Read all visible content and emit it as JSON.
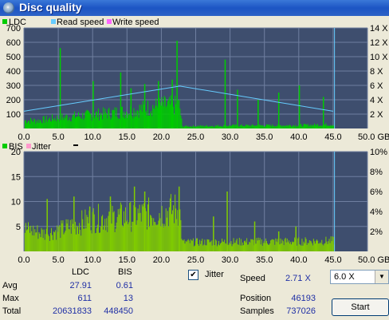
{
  "window": {
    "title": "Disc quality"
  },
  "chart_data": [
    {
      "type": "bar",
      "legend": [
        "LDC",
        "Read speed",
        "Write speed"
      ],
      "x_ticks": [
        "0.0",
        "5.0",
        "10.0",
        "15.0",
        "20.0",
        "25.0",
        "30.0",
        "35.0",
        "40.0",
        "45.0",
        "50.0 GB"
      ],
      "y_ticks_left": [
        "100",
        "200",
        "300",
        "400",
        "500",
        "600",
        "700"
      ],
      "y_ticks_right": [
        "2 X",
        "4 X",
        "6 X",
        "8 X",
        "10 X",
        "12 X",
        "14 X"
      ],
      "xlim": [
        0,
        50
      ],
      "ylim": [
        0,
        700
      ],
      "y2lim": [
        0,
        14
      ],
      "ldc_profile": {
        "x": [
          0,
          2,
          5,
          10,
          15,
          20,
          22.6,
          23,
          30,
          40,
          45
        ],
        "y": [
          55,
          55,
          75,
          95,
          120,
          160,
          160,
          15,
          20,
          22,
          28
        ]
      },
      "ldc_spikes": [
        {
          "x": 5.2,
          "y": 560
        },
        {
          "x": 10,
          "y": 330
        },
        {
          "x": 14,
          "y": 390
        },
        {
          "x": 15.5,
          "y": 280
        },
        {
          "x": 17.5,
          "y": 310
        },
        {
          "x": 19.5,
          "y": 330
        },
        {
          "x": 21.5,
          "y": 340
        },
        {
          "x": 22.2,
          "y": 611
        },
        {
          "x": 29.2,
          "y": 480
        },
        {
          "x": 31,
          "y": 270
        },
        {
          "x": 34,
          "y": 200
        },
        {
          "x": 37,
          "y": 250
        },
        {
          "x": 40,
          "y": 300
        },
        {
          "x": 43.5,
          "y": 220
        }
      ],
      "read_speed": {
        "x": [
          0,
          22.7,
          45
        ],
        "y": [
          2.4,
          5.9,
          2.4
        ]
      },
      "end_marker_x": 45.2
    },
    {
      "type": "bar",
      "legend": [
        "BIS",
        "Jitter"
      ],
      "x_ticks": [
        "0.0",
        "5.0",
        "10.0",
        "15.0",
        "20.0",
        "25.0",
        "30.0",
        "35.0",
        "40.0",
        "45.0",
        "50.0 GB"
      ],
      "y_ticks_left": [
        "5",
        "10",
        "15",
        "20"
      ],
      "y_ticks_right": [
        "2%",
        "4%",
        "6%",
        "8%",
        "10%"
      ],
      "xlim": [
        0,
        50
      ],
      "ylim": [
        0,
        20
      ],
      "y2lim": [
        0,
        10
      ],
      "bis_profile": {
        "x": [
          0,
          3,
          5,
          10,
          15,
          20,
          22.6,
          23,
          30,
          40,
          45
        ],
        "y": [
          4.5,
          3.6,
          4.2,
          6.5,
          7.0,
          7.8,
          8.5,
          1.8,
          1.9,
          2.0,
          2.1
        ]
      },
      "bis_spikes": [
        {
          "x": 3.3,
          "y": 10.5
        },
        {
          "x": 7.2,
          "y": 11
        },
        {
          "x": 9.5,
          "y": 9
        },
        {
          "x": 12.5,
          "y": 11
        },
        {
          "x": 16,
          "y": 13
        },
        {
          "x": 17.5,
          "y": 12
        },
        {
          "x": 22.5,
          "y": 13
        },
        {
          "x": 27.5,
          "y": 7
        },
        {
          "x": 29.5,
          "y": 12
        },
        {
          "x": 33.5,
          "y": 6
        },
        {
          "x": 37,
          "y": 4
        },
        {
          "x": 39.5,
          "y": 5
        }
      ],
      "end_marker_x": 45.2
    }
  ],
  "stats": {
    "header_ldc": "LDC",
    "header_bis": "BIS",
    "avg_label": "Avg",
    "max_label": "Max",
    "total_label": "Total",
    "avg_ldc": "27.91",
    "avg_bis": "0.61",
    "max_ldc": "611",
    "max_bis": "13",
    "total_ldc": "20631833",
    "total_bis": "448450"
  },
  "jitter": {
    "label": "Jitter",
    "checked": true,
    "check_mark": "✔"
  },
  "speed": {
    "label": "Speed",
    "value": "2.71 X"
  },
  "position": {
    "label": "Position",
    "value": "46193"
  },
  "samples": {
    "label": "Samples",
    "value": "737026"
  },
  "speed_select": {
    "value": "6.0 X",
    "arrow": "▼"
  },
  "start_button": {
    "label": "Start"
  },
  "colors": {
    "ldc": "#00cc00",
    "read_speed": "#66ccff",
    "write_speed": "#ff66ff",
    "bis": "#80cc00",
    "jitter": "#ff99cc",
    "plot_bg": "#3e4e6e",
    "grid": "#6f7fa0"
  }
}
